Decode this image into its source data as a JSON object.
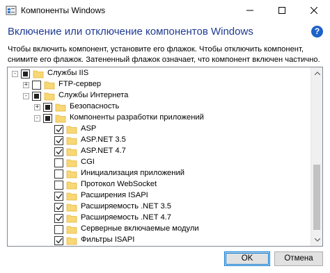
{
  "window": {
    "title": "Компоненты Windows",
    "icon": "windows-features-icon",
    "controls": [
      "minimize-icon",
      "maximize-icon",
      "close-icon"
    ]
  },
  "heading": "Включение или отключение компонентов Windows",
  "help_label": "?",
  "description": [
    "Чтобы включить компонент, установите его флажок. Чтобы отключить компонент,",
    "снимите его флажок. Затененный флажок означает, что компонент включен частично."
  ],
  "tree": {
    "rows": [
      {
        "label": "Службы IIS",
        "level": 0,
        "expander": "-",
        "state": "partial"
      },
      {
        "label": "FTP-сервер",
        "level": 1,
        "expander": "+",
        "state": "unchecked"
      },
      {
        "label": "Службы Интернета",
        "level": 1,
        "expander": "-",
        "state": "partial"
      },
      {
        "label": "Безопасность",
        "level": 2,
        "expander": "+",
        "state": "partial"
      },
      {
        "label": "Компоненты разработки приложений",
        "level": 2,
        "expander": "-",
        "state": "partial"
      },
      {
        "label": "ASP",
        "level": 3,
        "expander": "",
        "state": "checked"
      },
      {
        "label": "ASP.NET 3.5",
        "level": 3,
        "expander": "",
        "state": "checked"
      },
      {
        "label": "ASP.NET 4.7",
        "level": 3,
        "expander": "",
        "state": "checked"
      },
      {
        "label": "CGI",
        "level": 3,
        "expander": "",
        "state": "unchecked"
      },
      {
        "label": "Инициализация приложений",
        "level": 3,
        "expander": "",
        "state": "unchecked"
      },
      {
        "label": "Протокол WebSocket",
        "level": 3,
        "expander": "",
        "state": "unchecked"
      },
      {
        "label": "Расширения ISAPI",
        "level": 3,
        "expander": "",
        "state": "checked"
      },
      {
        "label": "Расширяемость .NET 3.5",
        "level": 3,
        "expander": "",
        "state": "checked"
      },
      {
        "label": "Расширяемость .NET 4.7",
        "level": 3,
        "expander": "",
        "state": "checked"
      },
      {
        "label": "Серверные включаемые модули",
        "level": 3,
        "expander": "",
        "state": "unchecked"
      },
      {
        "label": "Фильтры ISAPI",
        "level": 3,
        "expander": "",
        "state": "checked"
      }
    ],
    "colors": {
      "folder": "#f8d775",
      "folder_edge": "#e2b53c",
      "border": "#828790"
    }
  },
  "buttons": {
    "ok": "OK",
    "cancel": "Отмена"
  }
}
